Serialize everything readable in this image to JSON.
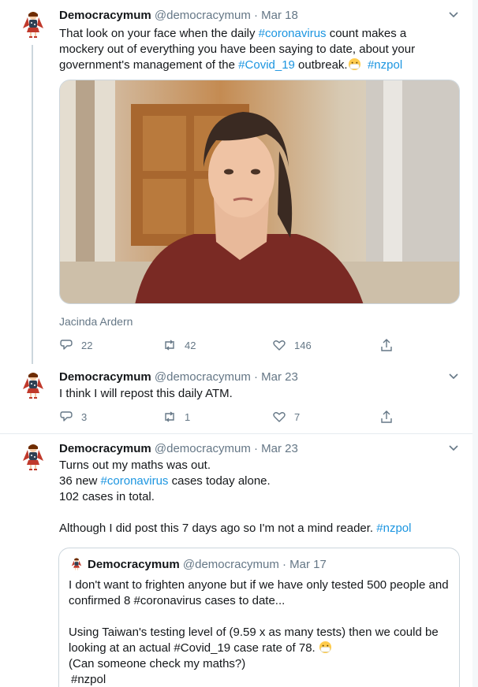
{
  "tweets": [
    {
      "name": "Democracymum",
      "handle": "@democracymum",
      "dot": "·",
      "date": "Mar 18",
      "text_parts": [
        "That look on your face when the daily ",
        "#coronavirus",
        " count makes a mockery out of everything you have been saying to date, about your government's management of the ",
        "#Covid_19",
        " outbreak.",
        "#nzpol"
      ],
      "media_caption": "Jacinda Ardern",
      "replies": "22",
      "retweets": "42",
      "likes": "146"
    },
    {
      "name": "Democracymum",
      "handle": "@democracymum",
      "dot": "·",
      "date": "Mar 23",
      "text": "I think I will repost this daily ATM.",
      "replies": "3",
      "retweets": "1",
      "likes": "7"
    },
    {
      "name": "Democracymum",
      "handle": "@democracymum",
      "dot": "·",
      "date": "Mar 23",
      "line1": "Turns out my maths was out.",
      "line2_a": "36 new ",
      "line2_tag": "#coronavirus",
      "line2_b": " cases today alone.",
      "line3": "102 cases in total.",
      "line4": "Although I did post this 7 days ago so I'm not a mind reader. ",
      "line4_tag": "#nzpol",
      "quote": {
        "name": "Democracymum",
        "handle": "@democracymum",
        "dot": "·",
        "date": "Mar 17",
        "line1": "I don't want to frighten anyone but if we have only tested 500 people and confirmed 8 #coronavirus cases to date...",
        "line2": "Using Taiwan's testing level of (9.59 x as many tests) then we could be looking at an actual #Covid_19 case rate of 78.",
        "line3": "(Can someone check my maths?)",
        "line4": "#nzpol"
      }
    }
  ],
  "colors": {
    "text": "#14171a",
    "secondary": "#657786",
    "link": "#1b95e0",
    "border": "#e6ecf0"
  },
  "icons": [
    "reply-icon",
    "retweet-icon",
    "like-icon",
    "share-icon",
    "caret-down-icon",
    "mask-emoji-icon"
  ]
}
